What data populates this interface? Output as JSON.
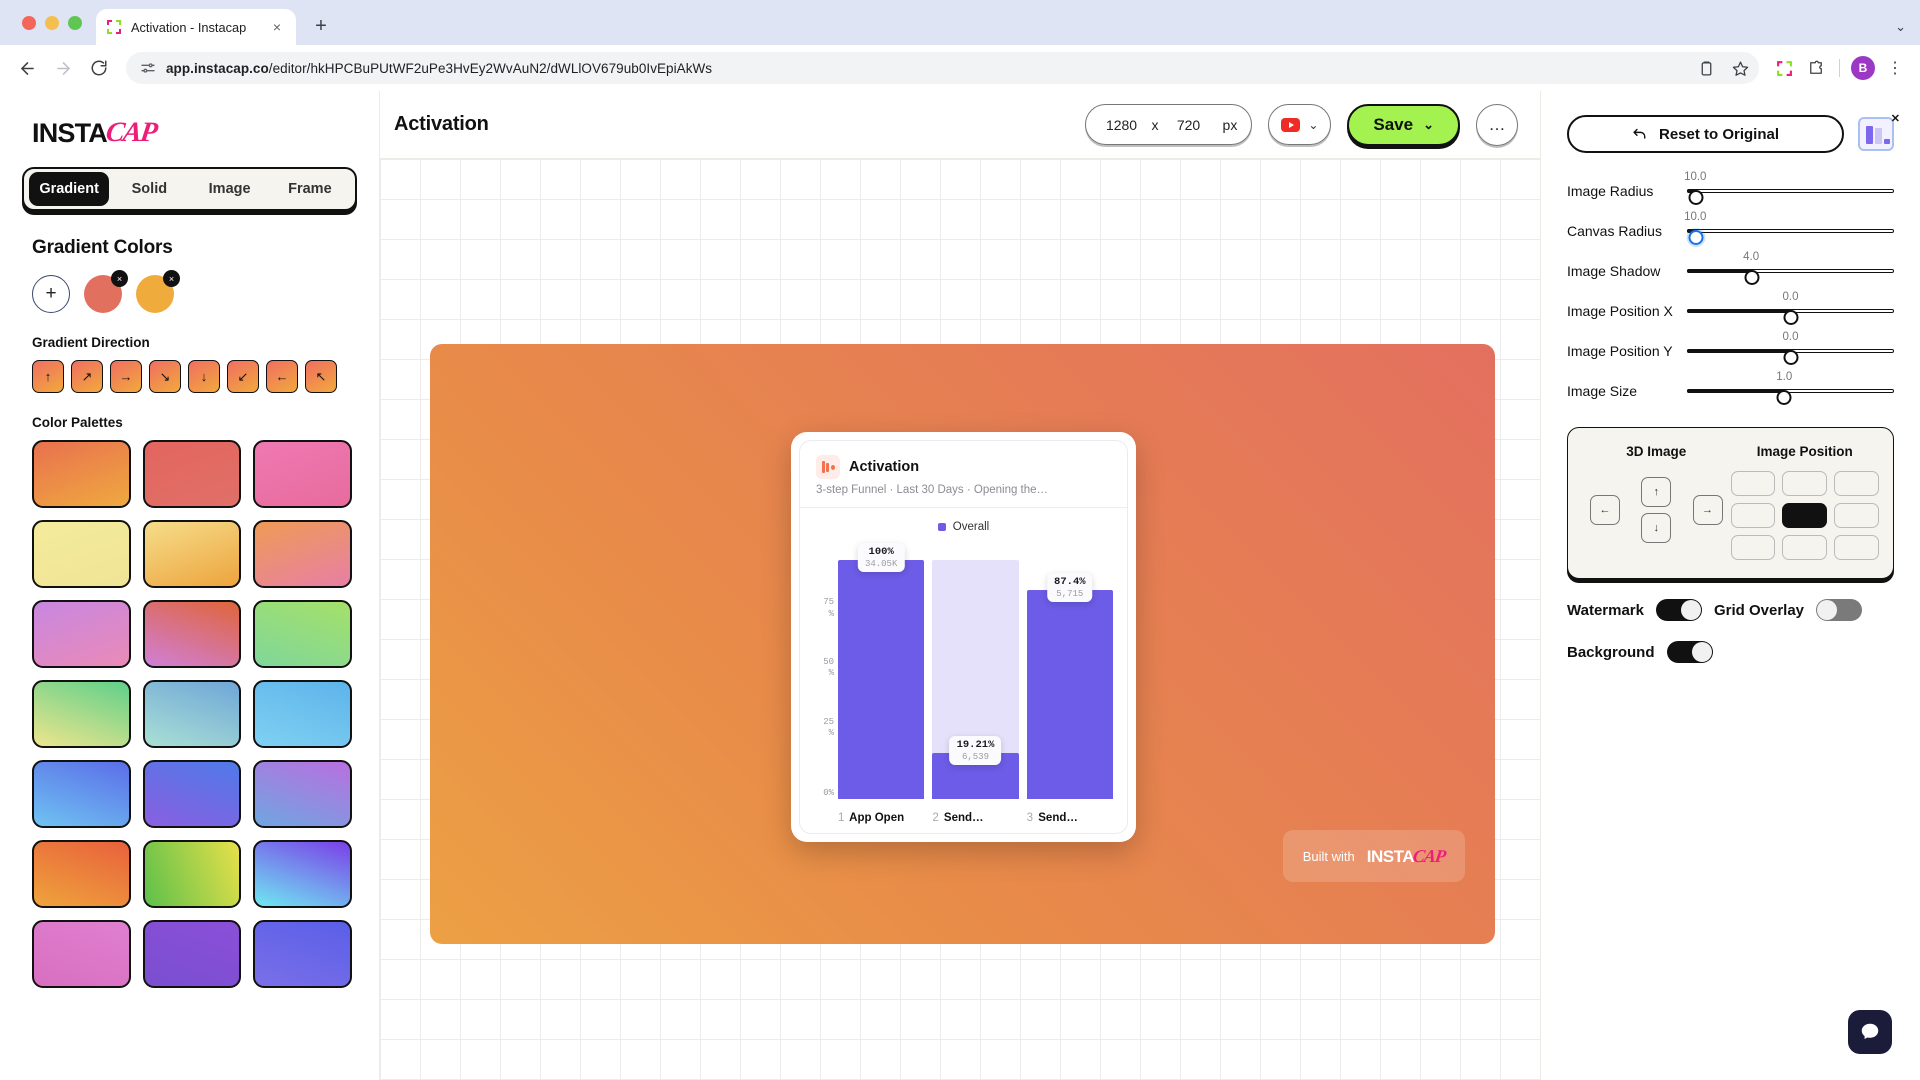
{
  "browser": {
    "tab": {
      "title": "Activation - Instacap",
      "favicon": "instacap-favicon-icon",
      "close": "×",
      "newtab": "+"
    },
    "nav": {
      "back": "←",
      "forward": "→",
      "reload": "⟳"
    },
    "omnibox": {
      "site_icon": "site-settings-icon",
      "url_bold": "app.instacap.co",
      "url_rest": "/editor/hkHPCBuPUtWF2uPe3HvEy2WvAuN2/dWLlOV679ub0IvEpiAkWs"
    },
    "actions": {
      "clipboard": "clipboard-icon",
      "bookmark": "star-icon",
      "instacap_ext": "instacap-extension-icon",
      "puzzle": "extensions-icon",
      "profile": "B",
      "menu": "⋮",
      "chevron": "⌄"
    }
  },
  "sidebar": {
    "logo": {
      "insta": "INSTA",
      "cap": "CAP"
    },
    "tabs": [
      {
        "label": "Gradient",
        "active": true
      },
      {
        "label": "Solid",
        "active": false
      },
      {
        "label": "Image",
        "active": false
      },
      {
        "label": "Frame",
        "active": false
      }
    ],
    "gradient_colors": {
      "title": "Gradient Colors",
      "add_label": "+",
      "swatches": [
        {
          "name": "coral",
          "color": "#e2705f"
        },
        {
          "name": "amber",
          "color": "#efab3c"
        }
      ],
      "remove_glyph": "×"
    },
    "gradient_direction": {
      "title": "Gradient Direction",
      "buttons": [
        "↑",
        "↗",
        "→",
        "↘",
        "↓",
        "↙",
        "←",
        "↖"
      ]
    },
    "color_palettes": {
      "title": "Color Palettes",
      "items": [
        "linear-gradient(160deg,#e9714f,#efa93f)",
        "linear-gradient(160deg,#e3655f,#e07068)",
        "linear-gradient(160deg,#ef79b2,#e76b9d)",
        "linear-gradient(160deg,#f4eb9c,#f0e495)",
        "linear-gradient(160deg,#f6dd8a,#eda43e)",
        "linear-gradient(160deg,#ef9b55,#e77fa5)",
        "linear-gradient(160deg,#c887e0,#ea8ab7)",
        "linear-gradient(200deg,#e0653a,#d07fd8)",
        "linear-gradient(200deg,#a5e06a,#7fd79a)",
        "linear-gradient(200deg,#5fd08a,#eee58d)",
        "linear-gradient(200deg,#6fa6d8,#a9e0d4)",
        "linear-gradient(200deg,#5db4ea,#7fd0f2)",
        "linear-gradient(200deg,#5b6de8,#6fc3f2)",
        "linear-gradient(200deg,#4f7ae8,#8a5fe0)",
        "linear-gradient(200deg,#b96fe0,#6fa6e0)",
        "linear-gradient(200deg,#e8613c,#efa33c)",
        "linear-gradient(250deg,#e8e04a,#5cc04a)",
        "linear-gradient(200deg,#7a3fe8,#6fe8f2)",
        "linear-gradient(200deg,#e07fd0,#d86fc0)",
        "linear-gradient(200deg,#8a4fd8,#7a4fd0)",
        "linear-gradient(200deg,#5a5fe8,#7a6fe8)"
      ]
    }
  },
  "canvas": {
    "title": "Activation",
    "dimensions": {
      "width": "1280",
      "height": "720",
      "x": "x",
      "unit": "px"
    },
    "format": {
      "icon": "youtube-icon",
      "chevron": "⌄"
    },
    "save": {
      "label": "Save",
      "chevron": "⌄",
      "color": "#a3f24f"
    },
    "more": "…",
    "watermark": {
      "built_with": "Built with",
      "insta": "INSTA",
      "cap": "CAP"
    },
    "background_gradient": "linear-gradient(45deg, #eca044 0%, #e88b49 35%, #e3705f 100%)"
  },
  "chart_data": {
    "type": "bar",
    "title": "Activation",
    "subtitle": "3-step Funnel · Last 30 Days · Opening the…",
    "legend": [
      "Overall"
    ],
    "legend_position": "top-center",
    "categories": [
      "App Open",
      "Send…",
      "Send…"
    ],
    "step_numbers": [
      "1",
      "2",
      "3"
    ],
    "values": [
      100,
      19.21,
      87.4
    ],
    "value_labels": [
      "100%",
      "19.21%",
      "87.4%"
    ],
    "count_labels": [
      "34.05K",
      "6,539",
      "5,715"
    ],
    "bar_bg_values": [
      100,
      100,
      19.21
    ],
    "ylabel": "",
    "xlabel": "",
    "yticks": [
      "0%",
      "25\n%",
      "50\n%",
      "75\n%"
    ],
    "ytick_values": [
      0,
      25,
      50,
      75
    ],
    "ylim": [
      0,
      108
    ],
    "grid": false,
    "series_color": "#6c5ce7",
    "track_color": "#e5e1fb"
  },
  "right_panel": {
    "reset": {
      "label": "Reset to Original",
      "icon": "undo-icon"
    },
    "thumbnail": {
      "name": "chart-thumbnail",
      "close": "✕"
    },
    "sliders": [
      {
        "label": "Image Radius",
        "value": "10.0",
        "pct": 4,
        "accent": "black"
      },
      {
        "label": "Canvas Radius",
        "value": "10.0",
        "pct": 4,
        "accent": "blue"
      },
      {
        "label": "Image Shadow",
        "value": "4.0",
        "pct": 31,
        "accent": "black"
      },
      {
        "label": "Image Position X",
        "value": "0.0",
        "pct": 50,
        "accent": "black"
      },
      {
        "label": "Image Position Y",
        "value": "0.0",
        "pct": 50,
        "accent": "black"
      },
      {
        "label": "Image Size",
        "value": "1.0",
        "pct": 47,
        "accent": "black"
      }
    ],
    "position_box": {
      "dpad_title": "3D Image",
      "dpad": {
        "up": "↑",
        "down": "↓",
        "left": "←",
        "right": "→"
      },
      "grid_title": "Image Position",
      "selected_index": 4
    },
    "toggles": [
      {
        "label": "Watermark",
        "on": true
      },
      {
        "label": "Grid Overlay",
        "on": false
      },
      {
        "label": "Background",
        "on": true
      }
    ],
    "chat": "chat-icon"
  }
}
